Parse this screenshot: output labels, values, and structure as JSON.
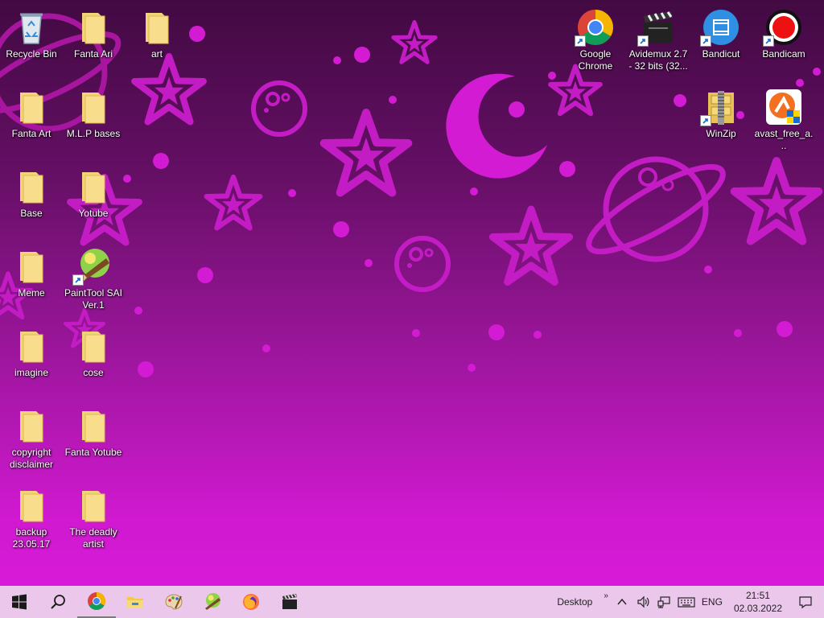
{
  "desktop": {
    "icons": [
      {
        "label": "Recycle Bin"
      },
      {
        "label": "Fanta Ari"
      },
      {
        "label": "art"
      },
      {
        "label": "Fanta Art"
      },
      {
        "label": "M.L.P bases"
      },
      {
        "label": "Base"
      },
      {
        "label": "Yotube"
      },
      {
        "label": "Meme"
      },
      {
        "label": "PaintTool SAI Ver.1"
      },
      {
        "label": "imagine"
      },
      {
        "label": "cose"
      },
      {
        "label": "copyright disclaimer"
      },
      {
        "label": "Fanta Yotube"
      },
      {
        "label": "backup 23.05.17"
      },
      {
        "label": "The deadly artist"
      },
      {
        "label": "Google Chrome"
      },
      {
        "label": "Avidemux 2.7 - 32 bits (32..."
      },
      {
        "label": "Bandicut"
      },
      {
        "label": "Bandicam"
      },
      {
        "label": "WinZip"
      },
      {
        "label": "avast_free_a..."
      }
    ]
  },
  "taskbar": {
    "pinned": [
      "windows-start",
      "search",
      "chrome",
      "file-explorer",
      "paint-palette",
      "painttool-sai",
      "firefox",
      "avidemux"
    ],
    "tray": {
      "toolbar_label": "Desktop",
      "chevron": "»",
      "language": "ENG",
      "time": "21:51",
      "date": "02.03.2022"
    }
  }
}
